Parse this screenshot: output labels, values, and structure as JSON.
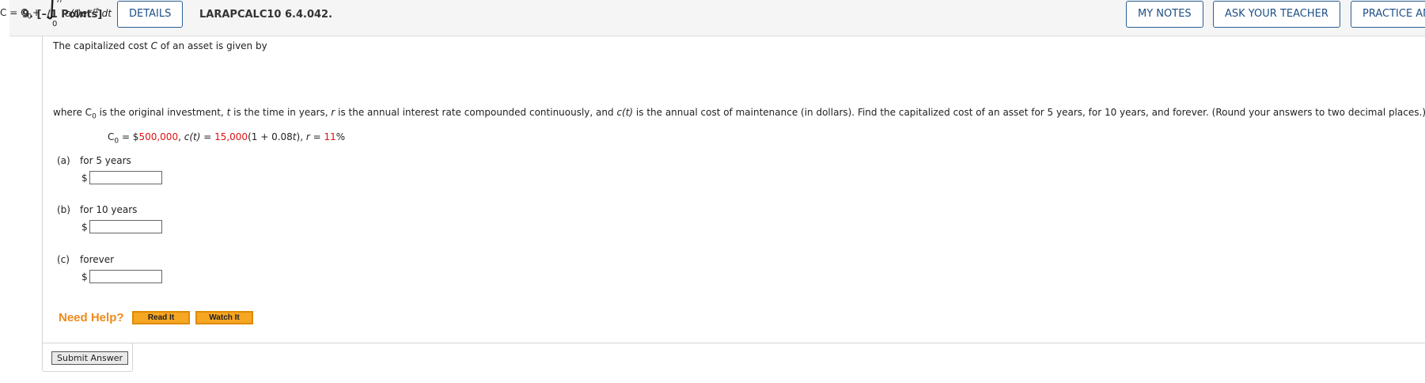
{
  "header": {
    "question_number": "9.",
    "points": "[–/1 Points]",
    "details_label": "DETAILS",
    "course_code": "LARAPCALC10 6.4.042.",
    "my_notes_label": "MY NOTES",
    "ask_teacher_label": "ASK YOUR TEACHER",
    "practice_label": "PRACTICE AN"
  },
  "problem": {
    "intro_pre": "The capitalized cost ",
    "intro_var": "C",
    "intro_post": " of an asset is given by",
    "formula": {
      "lhs": "C = C",
      "lhs_sub": "0",
      "plus": "+",
      "upper_limit": "n",
      "lower_limit": "0",
      "integrand": "c(t)e",
      "exponent": "−rt",
      "differential": "dt"
    },
    "where_text_1": "where C",
    "where_sub": "0",
    "where_text_2": " is the original investment, ",
    "where_t": "t",
    "where_text_3": " is the time in years, ",
    "where_r": "r",
    "where_text_4": " is the annual interest rate compounded continuously, and ",
    "where_ct": "c(t)",
    "where_text_5": " is the annual cost of maintenance (in dollars). Find the capitalized cost of an asset for 5 years, for 10 years, and forever. (Round your answers to two decimal places.)",
    "params": {
      "c0_label": "C",
      "c0_sub": "0",
      "eq1": " = $",
      "c0_value": "500,000",
      "sep1": ", ",
      "ct_label": "c(t)",
      "eq2": " = ",
      "ct_coef": "15,000",
      "ct_rest": "(1 + 0.08",
      "ct_t": "t",
      "ct_close": "), ",
      "r_label": "r",
      "eq3": " = ",
      "r_value": "11",
      "r_unit": "%"
    }
  },
  "parts": [
    {
      "letter": "(a)",
      "label": "for 5 years",
      "currency": "$",
      "value": ""
    },
    {
      "letter": "(b)",
      "label": "for 10 years",
      "currency": "$",
      "value": ""
    },
    {
      "letter": "(c)",
      "label": "forever",
      "currency": "$",
      "value": ""
    }
  ],
  "help": {
    "title": "Need Help?",
    "read_label": "Read It",
    "watch_label": "Watch It"
  },
  "submit_label": "Submit Answer"
}
